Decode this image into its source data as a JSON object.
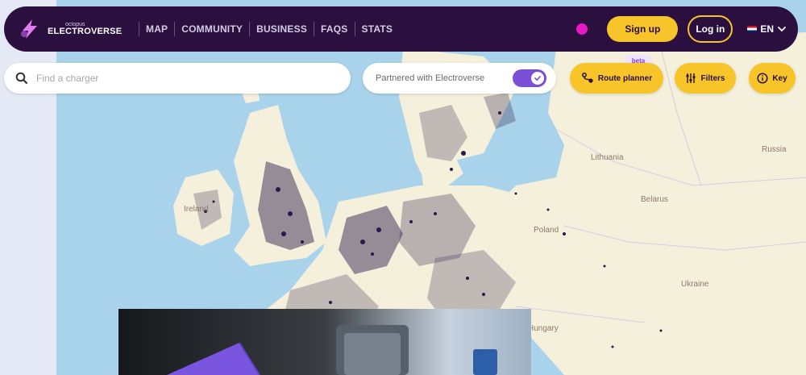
{
  "app": {
    "logo_small": "octopus",
    "logo_big": "ELECTROVERSE"
  },
  "nav": {
    "links": [
      "MAP",
      "COMMUNITY",
      "BUSINESS",
      "FAQS",
      "STATS"
    ],
    "signup_label": "Sign up",
    "login_label": "Log in",
    "language": "EN"
  },
  "search": {
    "placeholder": "Find a charger"
  },
  "partner_filter": {
    "label": "Partnered with Electroverse",
    "enabled": true
  },
  "actions": {
    "route_planner_label": "Route planner",
    "beta_badge": "beta",
    "filters_label": "Filters",
    "key_label": "Key"
  },
  "map_labels": {
    "lithuania": "Lithuania",
    "belarus": "Belarus",
    "poland": "Poland",
    "hungary": "Hungary",
    "ukraine": "Ukraine",
    "ireland": "Ireland",
    "russia": "Russia"
  },
  "colors": {
    "nav_bg": "#2a0f3f",
    "accent_yellow": "#f7c529",
    "toggle_purple": "#7a4fd6",
    "pink_dot": "#e619c7",
    "sea": "#a9d3ea",
    "land": "#f5f0dc",
    "charger_dot": "#2a1a4a"
  }
}
